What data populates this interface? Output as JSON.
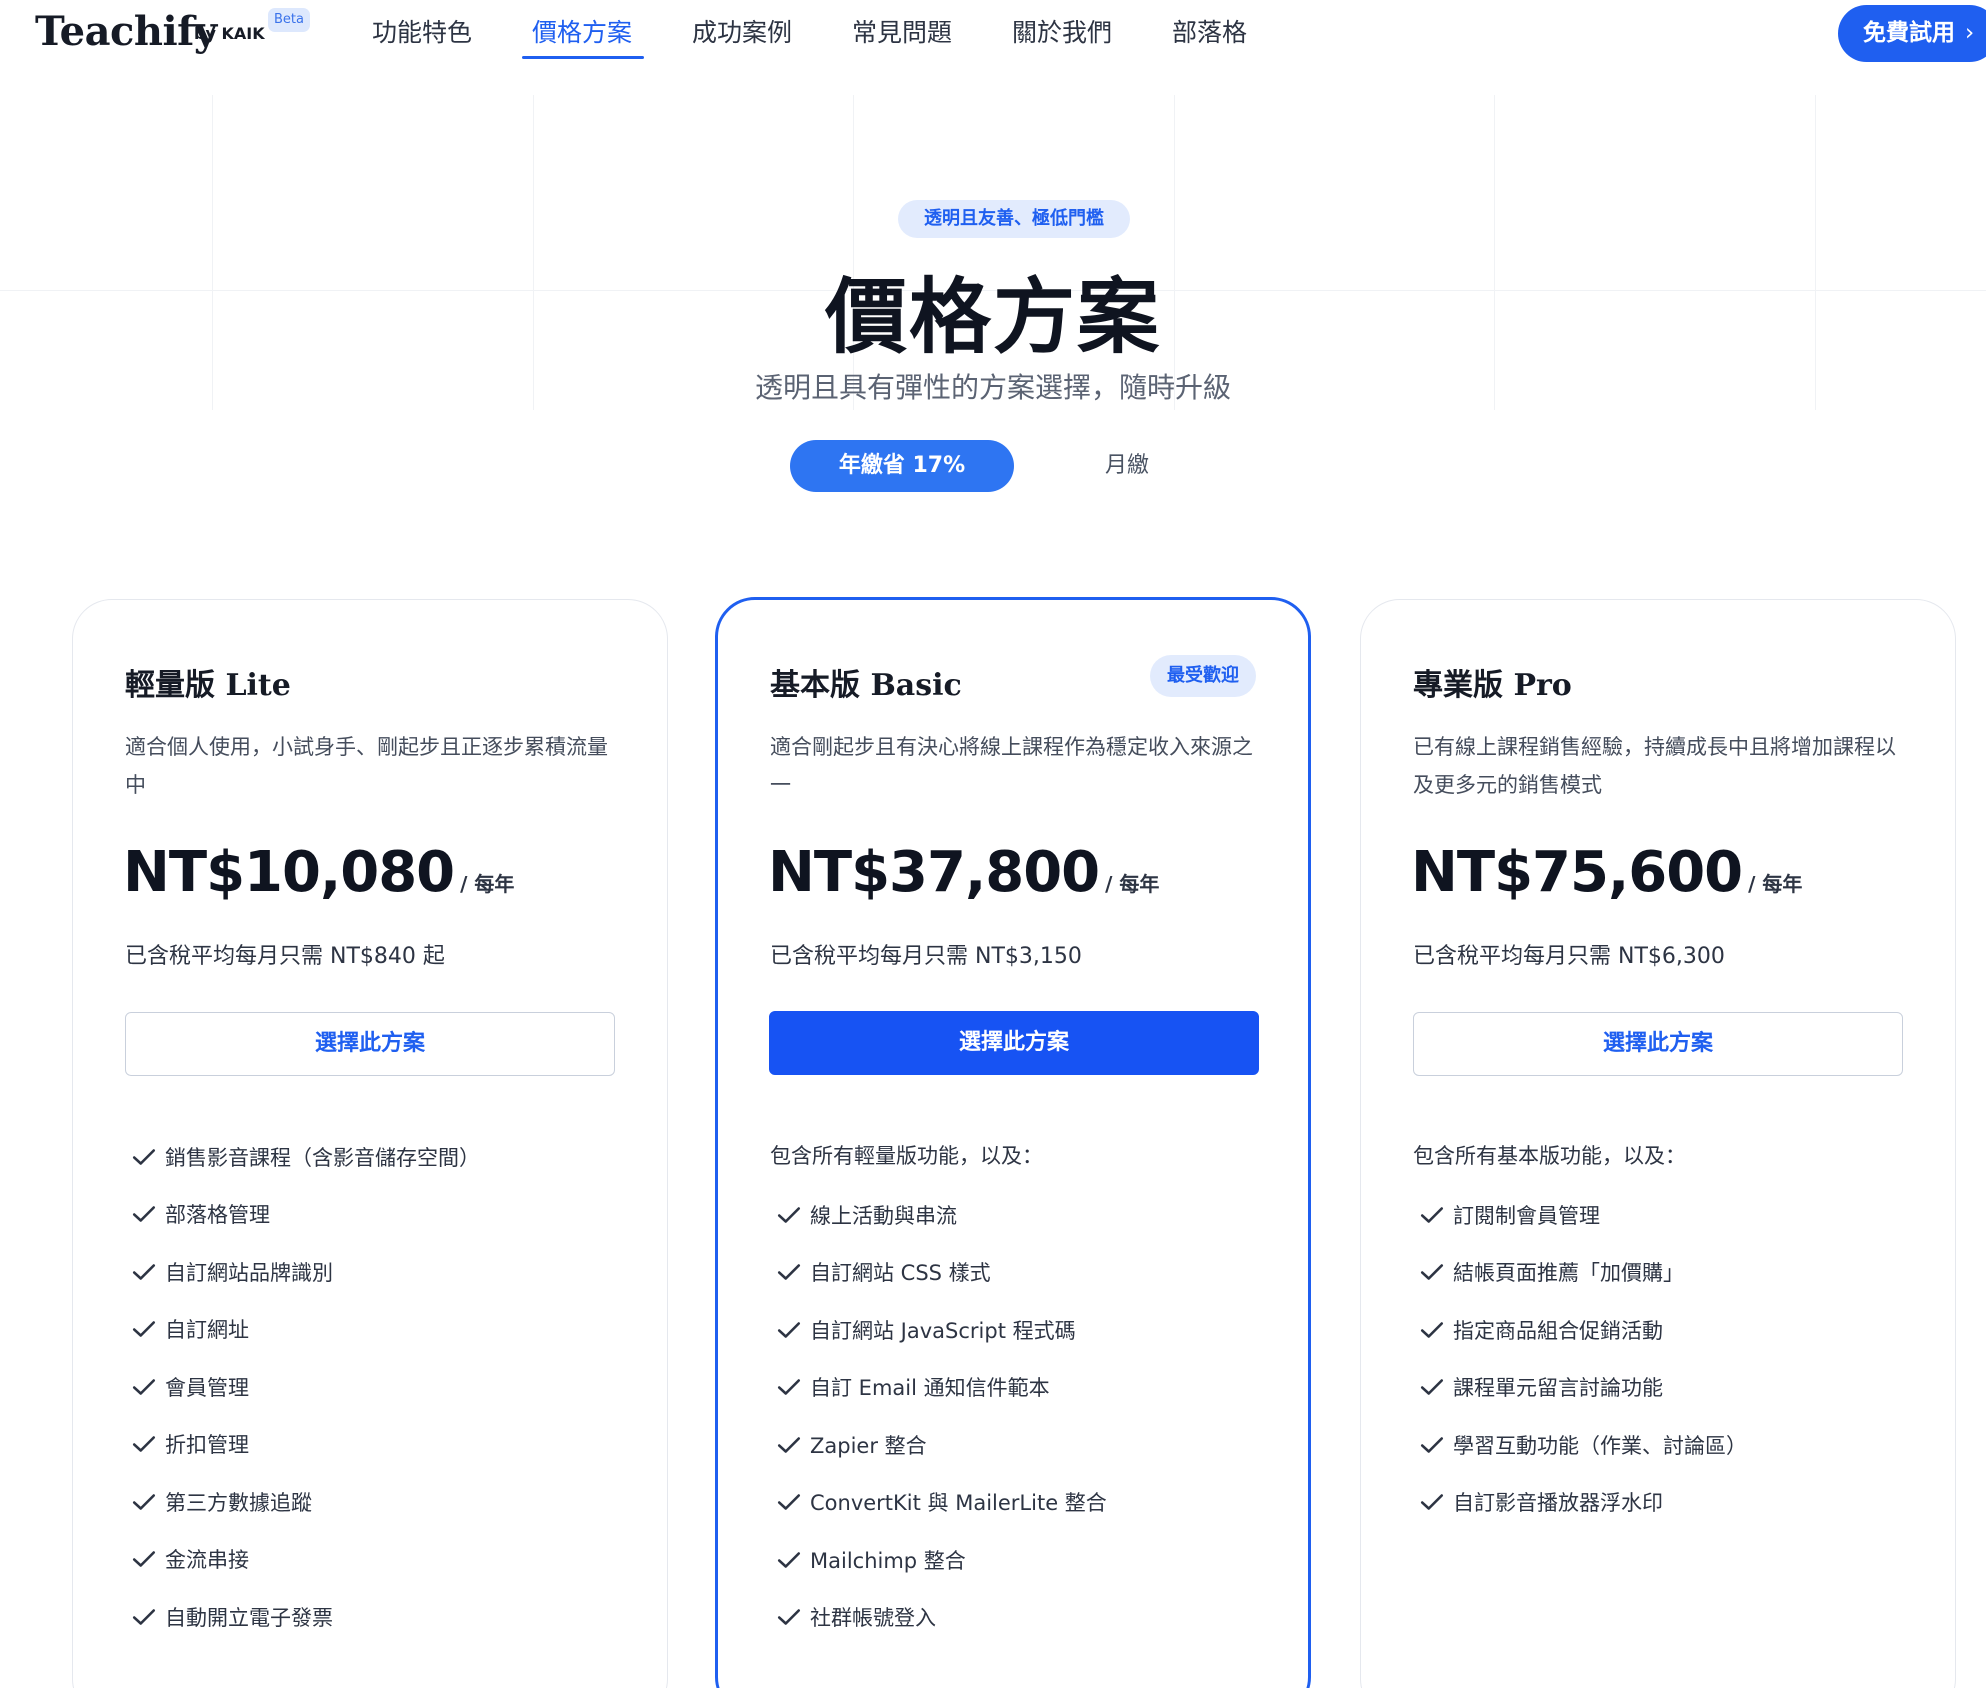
{
  "nav": {
    "logo": "Teachify",
    "by": "by KAIK",
    "beta": "Beta",
    "items": [
      {
        "label": "功能特色"
      },
      {
        "label": "價格方案"
      },
      {
        "label": "成功案例"
      },
      {
        "label": "常見問題"
      },
      {
        "label": "關於我們"
      },
      {
        "label": "部落格"
      }
    ],
    "active_index": 1,
    "cta": "免費試用",
    "cta_icon": "chevron-right-icon"
  },
  "hero": {
    "pill": "透明且友善、極低門檻",
    "title": "價格方案",
    "subtitle": "透明且具有彈性的方案選擇，隨時升級",
    "toggle": {
      "annual": "年繳省 17%",
      "monthly": "月繳",
      "selected": "annual"
    }
  },
  "plans": [
    {
      "name": "輕量版 Lite",
      "description": "適合個人使用，小試身手、剛起步且正逐步累積流量中",
      "price": "NT$10,080",
      "period": "/ 每年",
      "monthly_avg": "已含稅平均每月只需 NT$840 起",
      "button": "選擇此方案",
      "features": [
        "銷售影音課程（含影音儲存空間）",
        "部落格管理",
        "自訂網站品牌識別",
        "自訂網址",
        "會員管理",
        "折扣管理",
        "第三方數據追蹤",
        "金流串接",
        "自動開立電子發票"
      ]
    },
    {
      "name": "基本版 Basic",
      "badge": "最受歡迎",
      "description": "適合剛起步且有決心將線上課程作為穩定收入來源之一",
      "price": "NT$37,800",
      "period": "/ 每年",
      "monthly_avg": "已含稅平均每月只需 NT$3,150",
      "button": "選擇此方案",
      "intro": "包含所有輕量版功能，以及：",
      "features": [
        "線上活動與串流",
        "自訂網站 CSS 樣式",
        "自訂網站 JavaScript 程式碼",
        "自訂 Email 通知信件範本",
        "Zapier 整合",
        "ConvertKit 與 MailerLite 整合",
        "Mailchimp 整合",
        "社群帳號登入"
      ]
    },
    {
      "name": "專業版 Pro",
      "description": "已有線上課程銷售經驗，持續成長中且將增加課程以及更多元的銷售模式",
      "price": "NT$75,600",
      "period": "/ 每年",
      "monthly_avg": "已含稅平均每月只需 NT$6,300",
      "button": "選擇此方案",
      "intro": "包含所有基本版功能，以及：",
      "features": [
        "訂閱制會員管理",
        "結帳頁面推薦「加價購」",
        "指定商品組合促銷活動",
        "課程單元留言討論功能",
        "學習互動功能（作業、討論區）",
        "自訂影音播放器浮水印"
      ]
    }
  ],
  "colors": {
    "accent": "#1f5ff0",
    "accent_light": "#e2ebfd",
    "text_dark": "#0f1420",
    "text_body": "#2d3443",
    "border": "#e5e8ee"
  }
}
